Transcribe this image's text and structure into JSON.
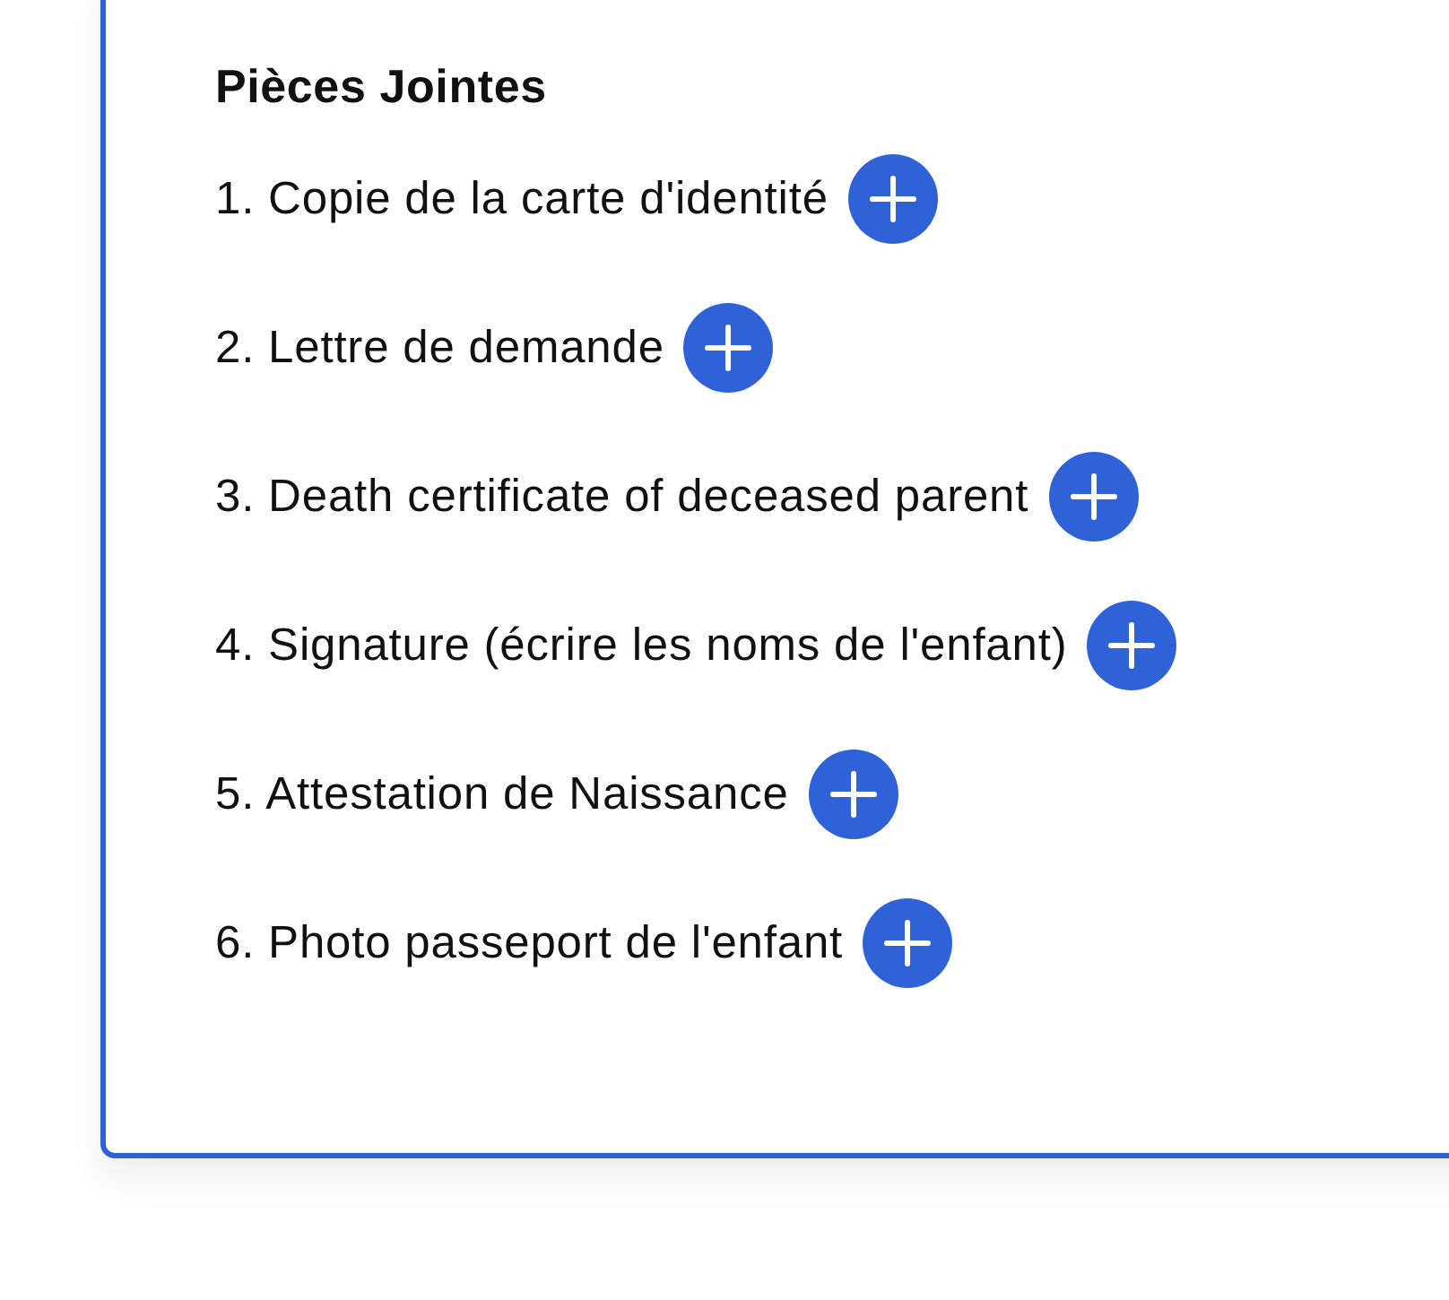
{
  "attachments": {
    "title": "Pièces Jointes",
    "items": [
      {
        "label": "1. Copie de la carte d'identité"
      },
      {
        "label": "2. Lettre de demande"
      },
      {
        "label": "3. Death certificate of deceased parent"
      },
      {
        "label": "4. Signature (écrire les noms de l'enfant)"
      },
      {
        "label": "5. Attestation de Naissance"
      },
      {
        "label": "6. Photo passeport de l'enfant"
      }
    ]
  }
}
